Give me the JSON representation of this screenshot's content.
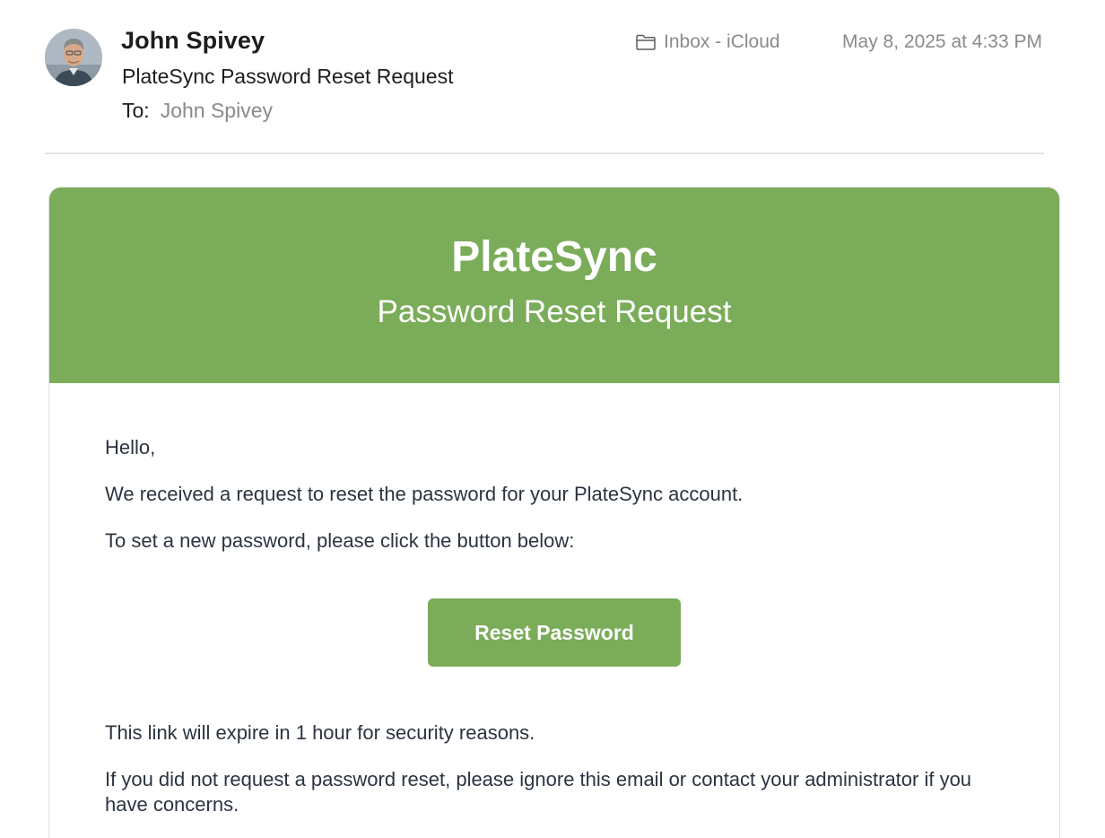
{
  "header": {
    "sender": "John Spivey",
    "subject": "PlateSync Password Reset Request",
    "to_label": "To:",
    "to_name": "John Spivey",
    "mailbox": "Inbox - iCloud",
    "date": "May 8, 2025 at 4:33 PM",
    "mailbox_icon": "folder-icon",
    "avatar": "sender-avatar-photo"
  },
  "email": {
    "brand": "PlateSync",
    "banner_subtitle": "Password Reset Request",
    "greeting": "Hello,",
    "line1": "We received a request to reset the password for your PlateSync account.",
    "line2": "To set a new password, please click the button below:",
    "button_label": "Reset Password",
    "expiry": "This link will expire in 1 hour for security reasons.",
    "disclaimer": "If you did not request a password reset, please ignore this email or contact your administrator if you have concerns."
  },
  "colors": {
    "brand_green": "#7aac59",
    "meta_gray": "#8a8a8e",
    "body_text": "#2b3440"
  }
}
